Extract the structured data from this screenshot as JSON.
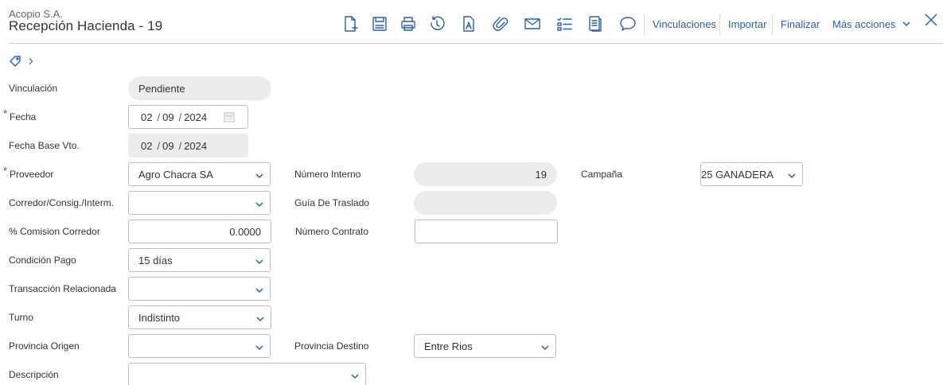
{
  "header": {
    "company": "Acopio S.A.",
    "title": "Recepción Hacienda - 19"
  },
  "toolbar": {
    "icons": [
      "new-document-icon",
      "save-icon",
      "print-icon",
      "history-icon",
      "text-document-icon",
      "attachment-icon",
      "mail-icon",
      "checklist-icon",
      "report-icon",
      "comment-icon"
    ],
    "links": {
      "vinculaciones": "Vinculaciones",
      "importar": "Importar",
      "finalizar": "Finalizar",
      "mas_acciones": "Más acciones"
    }
  },
  "form": {
    "vinculacion": {
      "label": "Vinculación",
      "value": "Pendiente"
    },
    "fecha": {
      "label": "Fecha",
      "required": "*",
      "day": "02",
      "month": "09",
      "year": "2024",
      "sep": "/"
    },
    "fecha_base_vto": {
      "label": "Fecha Base Vto.",
      "day": "02",
      "month": "09",
      "year": "2024",
      "sep": "/"
    },
    "proveedor": {
      "label": "Proveedor",
      "required": "*",
      "value": "Agro Chacra SA"
    },
    "numero_interno": {
      "label": "Número Interno",
      "value": "19"
    },
    "campana": {
      "label": "Campaña",
      "value": "25 GANADERA"
    },
    "corredor": {
      "label": "Corredor/Consig./Interm.",
      "value": ""
    },
    "guia_traslado": {
      "label": "Guía De Traslado",
      "value": ""
    },
    "comision_corredor": {
      "label": "% Comision Corredor",
      "value": "0.0000"
    },
    "numero_contrato": {
      "label": "Número Contrato",
      "value": ""
    },
    "condicion_pago": {
      "label": "Condición Pago",
      "value": "15 días"
    },
    "transaccion_relacionada": {
      "label": "Transacción Relacionada",
      "value": ""
    },
    "turno": {
      "label": "Turno",
      "value": "Indistinto"
    },
    "provincia_origen": {
      "label": "Provincia Origen",
      "value": ""
    },
    "provincia_destino": {
      "label": "Provincia Destino",
      "value": "Entre Rios"
    },
    "descripcion": {
      "label": "Descripción",
      "value": ""
    }
  },
  "colors": {
    "accent": "#2b5fa8",
    "required": "#e02020",
    "readonly_bg": "#ececec"
  }
}
